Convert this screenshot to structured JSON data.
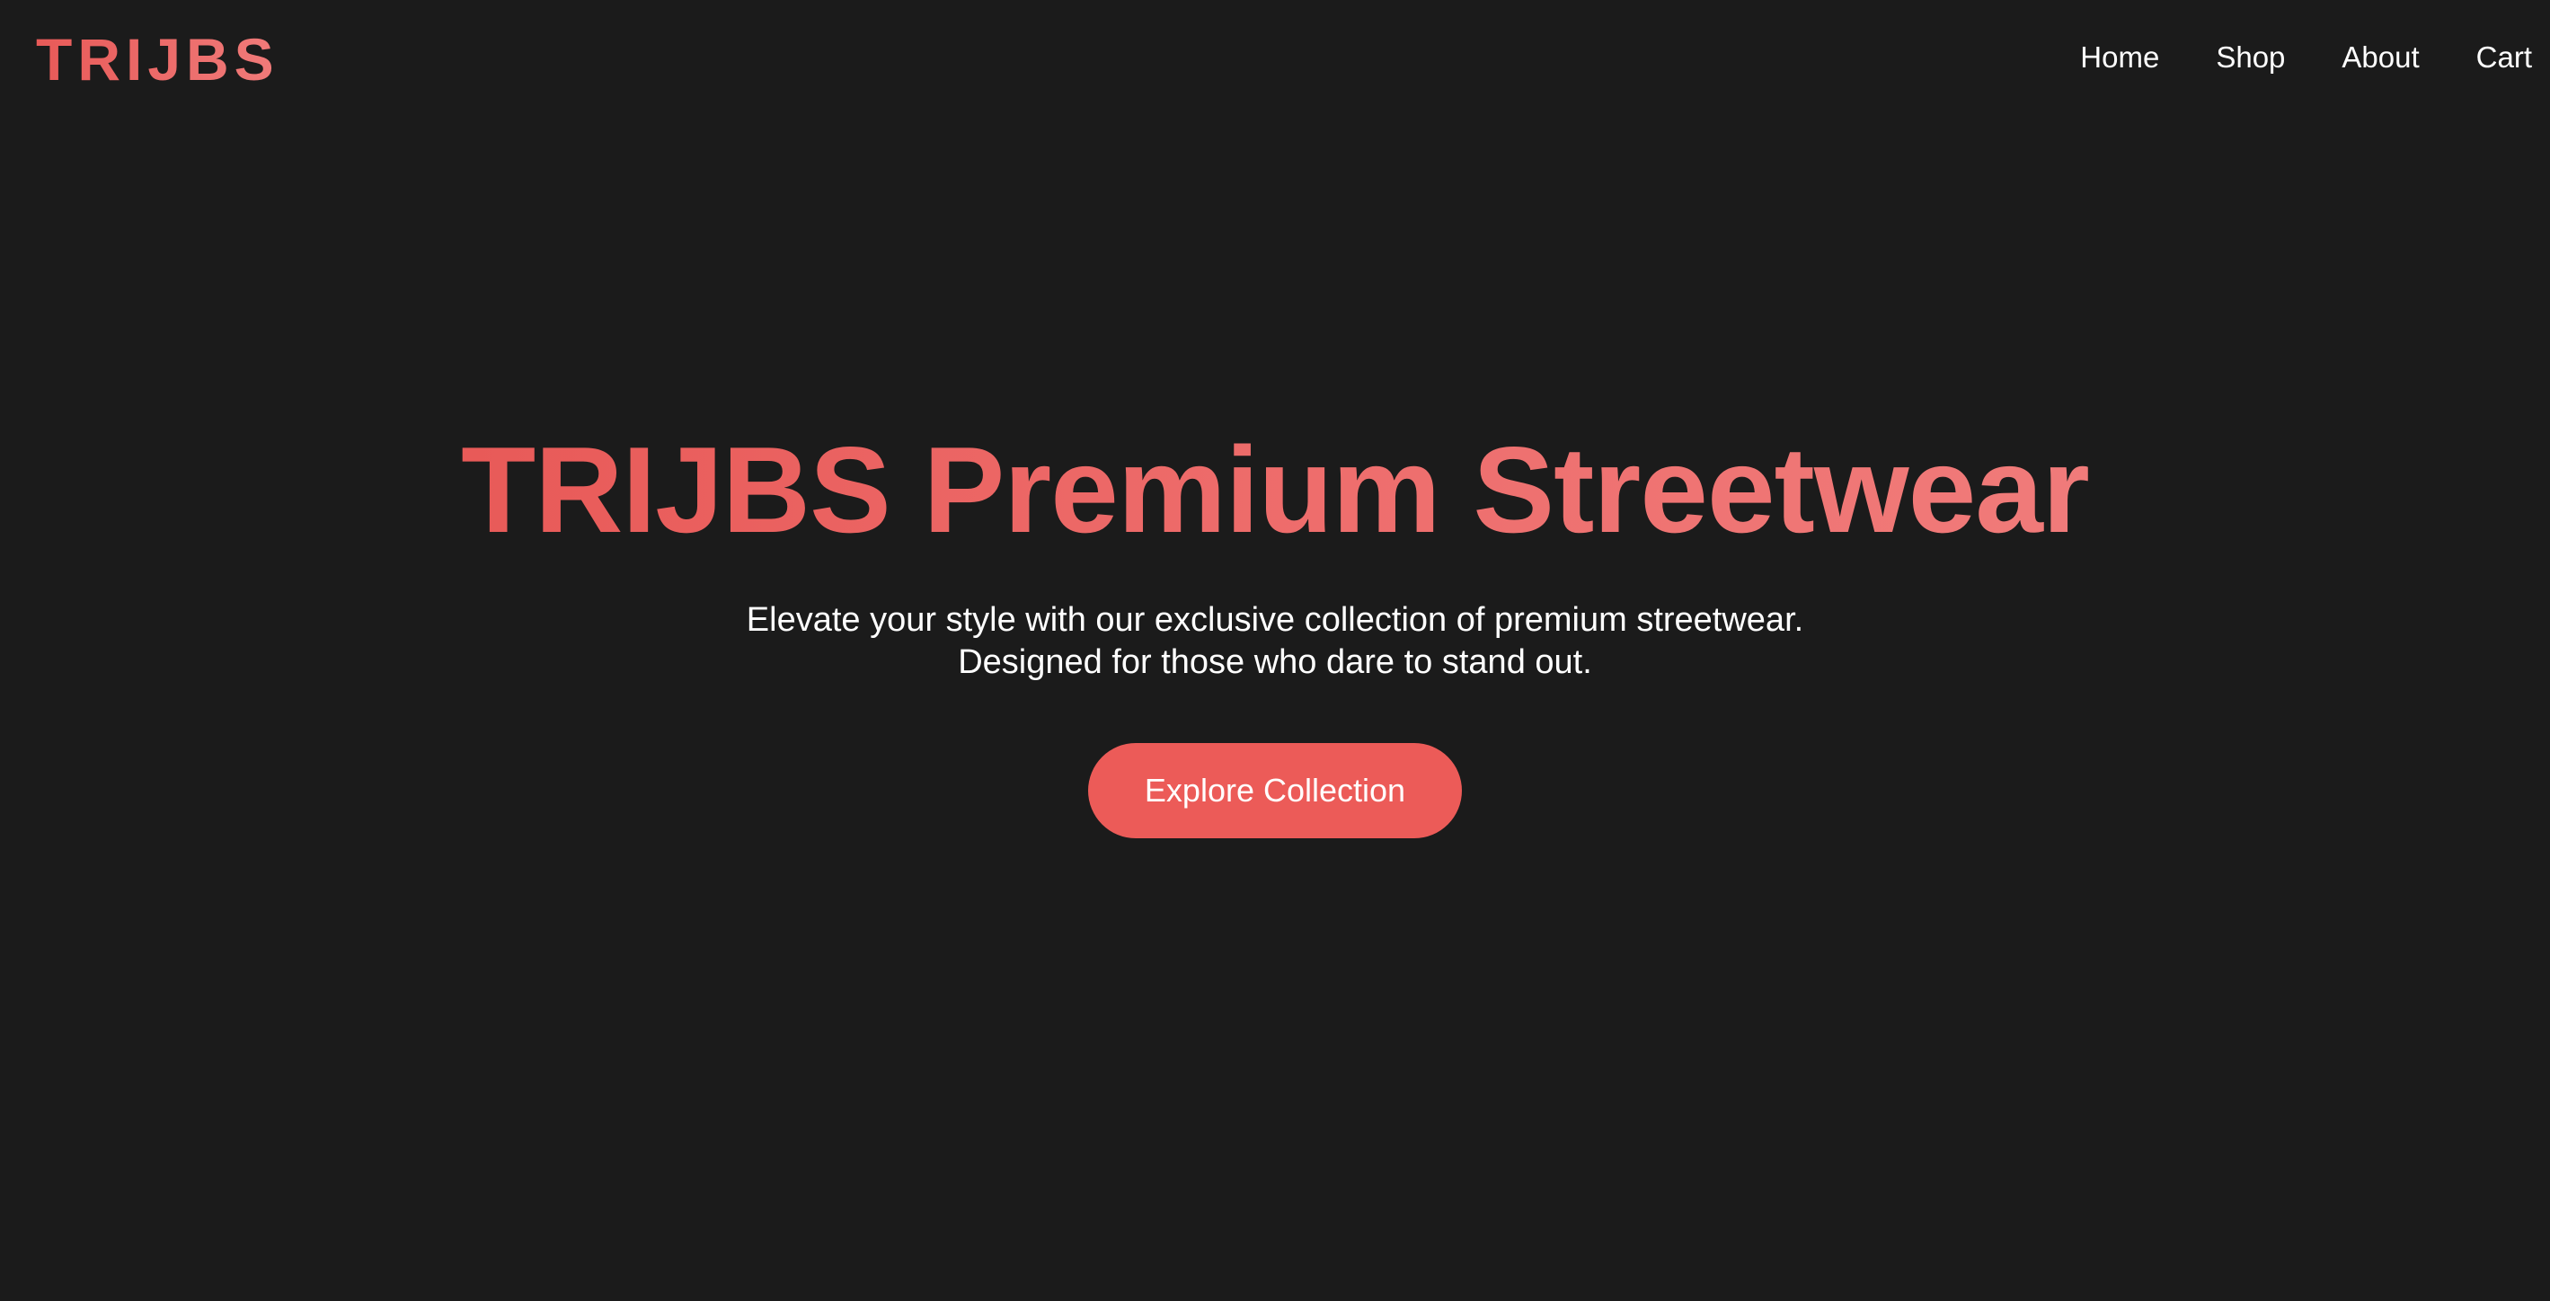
{
  "header": {
    "logo": "TRIJBS",
    "nav": [
      {
        "label": "Home"
      },
      {
        "label": "Shop"
      },
      {
        "label": "About"
      },
      {
        "label": "Cart"
      }
    ]
  },
  "hero": {
    "title": "TRIJBS Premium Streetwear",
    "subtitle_line1": "Elevate your style with our exclusive collection of premium streetwear.",
    "subtitle_line2": "Designed for those who dare to stand out.",
    "cta_label": "Explore Collection"
  },
  "colors": {
    "background": "#1b1b1b",
    "accent": "#ec5b58",
    "accent_light": "#f07b7a",
    "text": "#ffffff"
  }
}
